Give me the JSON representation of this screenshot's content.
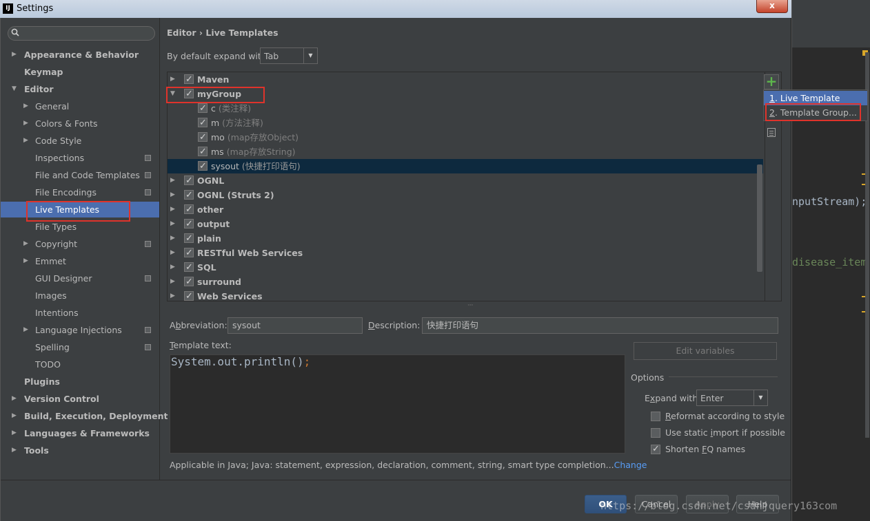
{
  "window": {
    "title": "Settings",
    "app_icon": "IJ",
    "close_label": "x"
  },
  "search": {
    "value": "",
    "placeholder": ""
  },
  "sidebar": {
    "items": [
      {
        "label": "Appearance & Behavior",
        "expander": "▶"
      },
      {
        "label": "Keymap"
      },
      {
        "label": "Editor",
        "expander": "▼"
      },
      {
        "label": "General",
        "expander": "▶"
      },
      {
        "label": "Colors & Fonts",
        "expander": "▶"
      },
      {
        "label": "Code Style",
        "expander": "▶"
      },
      {
        "label": "Inspections"
      },
      {
        "label": "File and Code Templates"
      },
      {
        "label": "File Encodings"
      },
      {
        "label": "Live Templates"
      },
      {
        "label": "File Types"
      },
      {
        "label": "Copyright",
        "expander": "▶"
      },
      {
        "label": "Emmet",
        "expander": "▶"
      },
      {
        "label": "GUI Designer"
      },
      {
        "label": "Images"
      },
      {
        "label": "Intentions"
      },
      {
        "label": "Language Injections",
        "expander": "▶"
      },
      {
        "label": "Spelling"
      },
      {
        "label": "TODO"
      },
      {
        "label": "Plugins"
      },
      {
        "label": "Version Control",
        "expander": "▶"
      },
      {
        "label": "Build, Execution, Deployment",
        "expander": "▶"
      },
      {
        "label": "Languages & Frameworks",
        "expander": "▶"
      },
      {
        "label": "Tools",
        "expander": "▶"
      }
    ]
  },
  "breadcrumb": {
    "parent": "Editor",
    "separator": "›",
    "current": "Live Templates"
  },
  "expand_default": {
    "label": "By default expand with",
    "value": "Tab",
    "arrow": "▼"
  },
  "templates": {
    "rows": [
      {
        "name": "Maven",
        "desc": "",
        "expander": "▶"
      },
      {
        "name": "myGroup",
        "desc": "",
        "expander": "▼"
      },
      {
        "name": "c",
        "desc": "(类注释)"
      },
      {
        "name": "m",
        "desc": "(方法注释)"
      },
      {
        "name": "mo",
        "desc": "(map存放Object)"
      },
      {
        "name": "ms",
        "desc": "(map存放String)"
      },
      {
        "name": "sysout",
        "desc": "(快捷打印语句)"
      },
      {
        "name": "OGNL",
        "desc": "",
        "expander": "▶"
      },
      {
        "name": "OGNL (Struts 2)",
        "desc": "",
        "expander": "▶"
      },
      {
        "name": "other",
        "desc": "",
        "expander": "▶"
      },
      {
        "name": "output",
        "desc": "",
        "expander": "▶"
      },
      {
        "name": "plain",
        "desc": "",
        "expander": "▶"
      },
      {
        "name": "RESTful Web Services",
        "desc": "",
        "expander": "▶"
      },
      {
        "name": "SQL",
        "desc": "",
        "expander": "▶"
      },
      {
        "name": "surround",
        "desc": "",
        "expander": "▶"
      },
      {
        "name": "Web Services",
        "desc": "",
        "expander": "▶"
      }
    ],
    "splitter": "·····",
    "add_label": "+"
  },
  "add_menu": {
    "items": [
      {
        "mnemonic": "1",
        "label": ". Live Template"
      },
      {
        "mnemonic": "2",
        "label": ". Template Group..."
      }
    ]
  },
  "details": {
    "abbreviation_label_pre": "A",
    "abbreviation_label_mn": "b",
    "abbreviation_label_post": "breviation:",
    "abbreviation_value": "sysout",
    "description_label_mn": "D",
    "description_label_post": "escription:",
    "description_value": "快捷打印语句",
    "template_label_mn": "T",
    "template_label_post": "emplate text:",
    "template_code": "System.out.println()",
    "template_code_end": ";",
    "edit_variables": "Edit variables",
    "options_title": "Options",
    "expand_with_label_pre": "E",
    "expand_with_label_mn": "x",
    "expand_with_label_post": "pand with",
    "expand_with_value": "Enter",
    "opt_reformat_mn": "R",
    "opt_reformat_post": "eformat according to style",
    "opt_static_pre": "Use static ",
    "opt_static_mn": "i",
    "opt_static_post": "mport if possible",
    "opt_fq_pre": "Shorten ",
    "opt_fq_mn": "F",
    "opt_fq_post": "Q names",
    "opt_reformat_checked": false,
    "opt_static_checked": false,
    "opt_fq_checked": true,
    "applicable": "Applicable in Java; Java: statement, expression, declaration, comment, string, smart type completion...",
    "change_link": "Change"
  },
  "footer": {
    "ok": "OK",
    "cancel": "Cancel",
    "apply": "Apply",
    "help": "Help"
  },
  "background_editor": {
    "line1": "nputStream);",
    "line2": "disease_item"
  },
  "watermark": "https://blog.csdn.net/csdnjquery163com",
  "colors": {
    "accent": "#4b6eaf",
    "highlight_box": "#e0332b",
    "selected_row": "#0d293e",
    "link": "#589df6"
  }
}
